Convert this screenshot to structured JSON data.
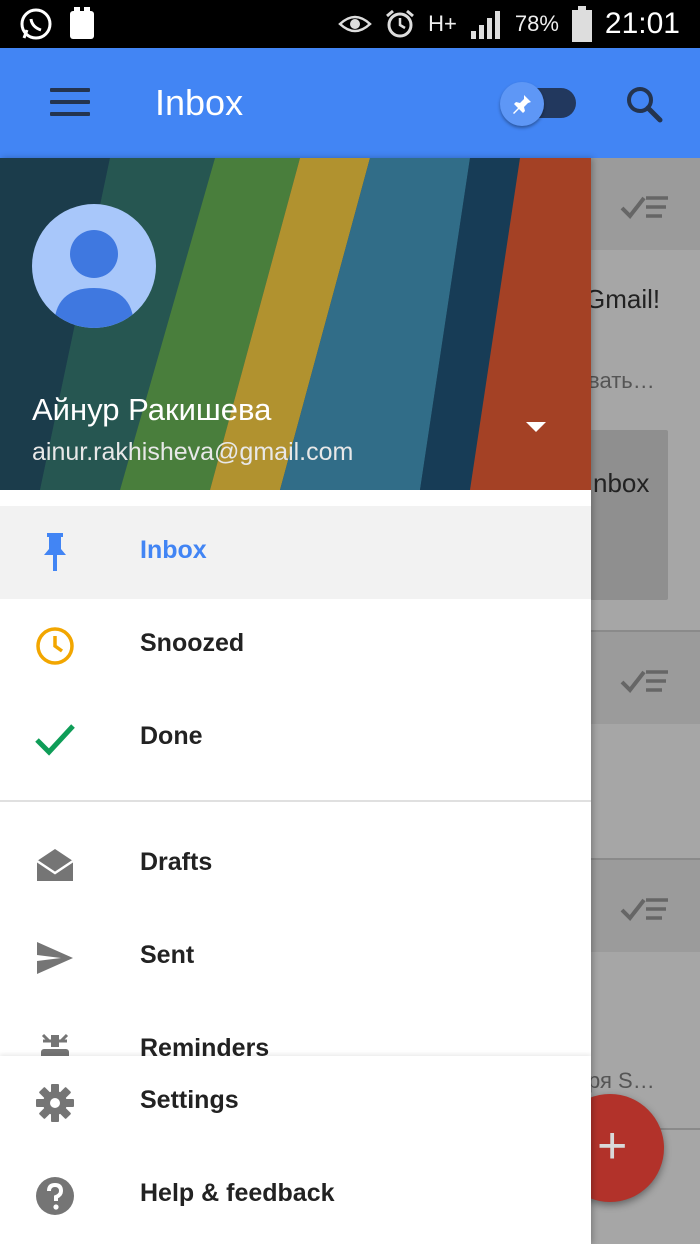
{
  "status_bar": {
    "battery_text": "78%",
    "time": "21:01",
    "network_text": "H+"
  },
  "app_bar": {
    "title": "Inbox",
    "color": "#4285f4"
  },
  "drawer": {
    "account": {
      "name": "Айнур Ракишева",
      "email": "ainur.rakhisheva@gmail.com"
    },
    "items": [
      {
        "label": "Inbox",
        "icon": "pin-icon",
        "active": true
      },
      {
        "label": "Snoozed",
        "icon": "clock-icon"
      },
      {
        "label": "Done",
        "icon": "check-icon"
      },
      {
        "label": "Drafts",
        "icon": "drafts-icon"
      },
      {
        "label": "Sent",
        "icon": "send-icon"
      },
      {
        "label": "Reminders",
        "icon": "reminder-icon"
      }
    ],
    "bottom_items": [
      {
        "label": "Settings",
        "icon": "gear-icon"
      },
      {
        "label": "Help & feedback",
        "icon": "help-icon"
      }
    ]
  },
  "background_list": {
    "card_title_partial": "Gmail!",
    "card_sub_partial": "вать…",
    "inbox_card_partial": "nbox",
    "bottom_text_partial": "ря S…"
  }
}
